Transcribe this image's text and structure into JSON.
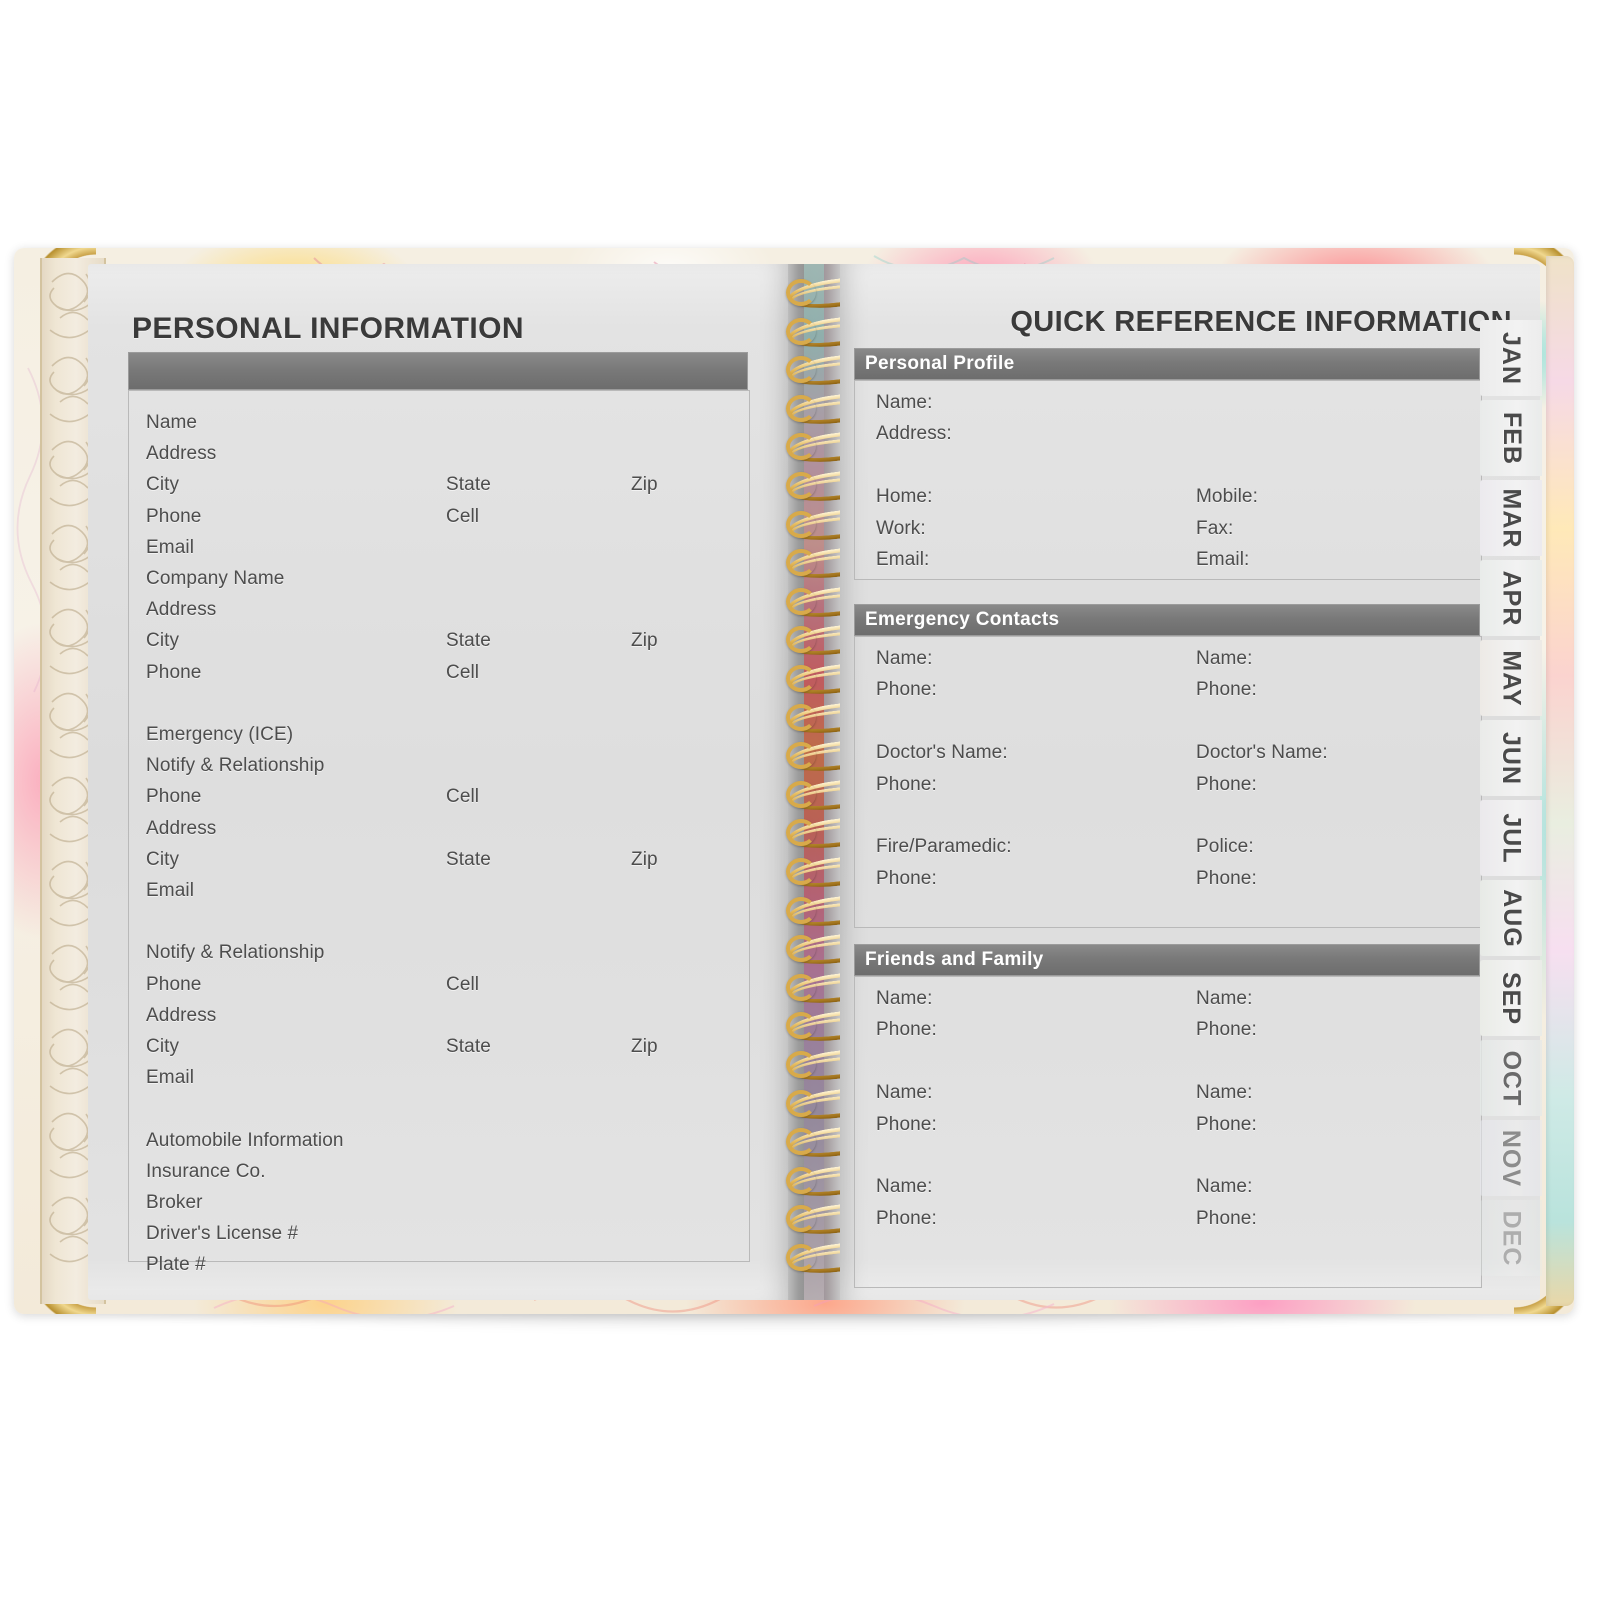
{
  "colors": {
    "bar_gray": "#757575",
    "page_bg": "#d9d9d9",
    "text_gray": "#4d4d4d",
    "title_dark": "#3a3a3a",
    "gold": "#d8aa4a"
  },
  "left_page": {
    "title": "PERSONAL INFORMATION",
    "header_bar_label": "",
    "fields": [
      {
        "label": "Name",
        "col": 1,
        "row": 0
      },
      {
        "label": "Address",
        "col": 1,
        "row": 1
      },
      {
        "label": "City",
        "col": 1,
        "row": 2
      },
      {
        "label": "State",
        "col": 2,
        "row": 2
      },
      {
        "label": "Zip",
        "col": 3,
        "row": 2
      },
      {
        "label": "Phone",
        "col": 1,
        "row": 3
      },
      {
        "label": "Cell",
        "col": 2,
        "row": 3
      },
      {
        "label": "Email",
        "col": 1,
        "row": 4
      },
      {
        "label": "Company Name",
        "col": 1,
        "row": 5
      },
      {
        "label": "Address",
        "col": 1,
        "row": 6
      },
      {
        "label": "City",
        "col": 1,
        "row": 7
      },
      {
        "label": "State",
        "col": 2,
        "row": 7
      },
      {
        "label": "Zip",
        "col": 3,
        "row": 7
      },
      {
        "label": "Phone",
        "col": 1,
        "row": 8
      },
      {
        "label": "Cell",
        "col": 2,
        "row": 8
      },
      {
        "label": "Emergency (ICE)",
        "col": 1,
        "row": 10
      },
      {
        "label": "Notify & Relationship",
        "col": 1,
        "row": 11
      },
      {
        "label": "Phone",
        "col": 1,
        "row": 12
      },
      {
        "label": "Cell",
        "col": 2,
        "row": 12
      },
      {
        "label": "Address",
        "col": 1,
        "row": 13
      },
      {
        "label": "City",
        "col": 1,
        "row": 14
      },
      {
        "label": "State",
        "col": 2,
        "row": 14
      },
      {
        "label": "Zip",
        "col": 3,
        "row": 14
      },
      {
        "label": "Email",
        "col": 1,
        "row": 15
      },
      {
        "label": "Notify & Relationship",
        "col": 1,
        "row": 17
      },
      {
        "label": "Phone",
        "col": 1,
        "row": 18
      },
      {
        "label": "Cell",
        "col": 2,
        "row": 18
      },
      {
        "label": "Address",
        "col": 1,
        "row": 19
      },
      {
        "label": "City",
        "col": 1,
        "row": 20
      },
      {
        "label": "State",
        "col": 2,
        "row": 20
      },
      {
        "label": "Zip",
        "col": 3,
        "row": 20
      },
      {
        "label": "Email",
        "col": 1,
        "row": 21
      },
      {
        "label": "Automobile Information",
        "col": 1,
        "row": 23
      },
      {
        "label": "Insurance Co.",
        "col": 1,
        "row": 24
      },
      {
        "label": "Broker",
        "col": 1,
        "row": 25
      },
      {
        "label": "Driver's License #",
        "col": 1,
        "row": 26
      },
      {
        "label": "Plate #",
        "col": 1,
        "row": 27
      }
    ]
  },
  "right_page": {
    "title": "QUICK REFERENCE INFORMATION",
    "sections": [
      {
        "heading": "Personal Profile",
        "fields": [
          {
            "label": "Name:",
            "col": 1,
            "row": 0
          },
          {
            "label": "Address:",
            "col": 1,
            "row": 1
          },
          {
            "label": "Home:",
            "col": 1,
            "row": 3
          },
          {
            "label": "Mobile:",
            "col": 2,
            "row": 3
          },
          {
            "label": "Work:",
            "col": 1,
            "row": 4
          },
          {
            "label": "Fax:",
            "col": 2,
            "row": 4
          },
          {
            "label": "Email:",
            "col": 1,
            "row": 5
          },
          {
            "label": "Email:",
            "col": 2,
            "row": 5
          }
        ]
      },
      {
        "heading": "Emergency Contacts",
        "fields": [
          {
            "label": "Name:",
            "col": 1,
            "row": 0
          },
          {
            "label": "Name:",
            "col": 2,
            "row": 0
          },
          {
            "label": "Phone:",
            "col": 1,
            "row": 1
          },
          {
            "label": "Phone:",
            "col": 2,
            "row": 1
          },
          {
            "label": "Doctor's Name:",
            "col": 1,
            "row": 3
          },
          {
            "label": "Doctor's  Name:",
            "col": 2,
            "row": 3
          },
          {
            "label": "Phone:",
            "col": 1,
            "row": 4
          },
          {
            "label": "Phone:",
            "col": 2,
            "row": 4
          },
          {
            "label": "Fire/Paramedic:",
            "col": 1,
            "row": 6
          },
          {
            "label": "Police:",
            "col": 2,
            "row": 6
          },
          {
            "label": "Phone:",
            "col": 1,
            "row": 7
          },
          {
            "label": "Phone:",
            "col": 2,
            "row": 7
          }
        ]
      },
      {
        "heading": "Friends and Family",
        "fields": [
          {
            "label": "Name:",
            "col": 1,
            "row": 0
          },
          {
            "label": "Name:",
            "col": 2,
            "row": 0
          },
          {
            "label": "Phone:",
            "col": 1,
            "row": 1
          },
          {
            "label": "Phone:",
            "col": 2,
            "row": 1
          },
          {
            "label": "Name:",
            "col": 1,
            "row": 3
          },
          {
            "label": "Name:",
            "col": 2,
            "row": 3
          },
          {
            "label": "Phone:",
            "col": 1,
            "row": 4
          },
          {
            "label": "Phone:",
            "col": 2,
            "row": 4
          },
          {
            "label": "Name:",
            "col": 1,
            "row": 6
          },
          {
            "label": "Name:",
            "col": 2,
            "row": 6
          },
          {
            "label": "Phone:",
            "col": 1,
            "row": 7
          },
          {
            "label": "Phone:",
            "col": 2,
            "row": 7
          }
        ]
      }
    ]
  },
  "month_tabs": [
    {
      "label": "JAN"
    },
    {
      "label": "FEB"
    },
    {
      "label": "MAR"
    },
    {
      "label": "APR"
    },
    {
      "label": "MAY"
    },
    {
      "label": "JUN"
    },
    {
      "label": "JUL"
    },
    {
      "label": "AUG"
    },
    {
      "label": "SEP"
    },
    {
      "label": "OCT"
    },
    {
      "label": "NOV"
    },
    {
      "label": "DEC"
    }
  ],
  "binding": {
    "type": "spiral-coil",
    "coil_count": 26,
    "color": "#d8aa4a"
  }
}
